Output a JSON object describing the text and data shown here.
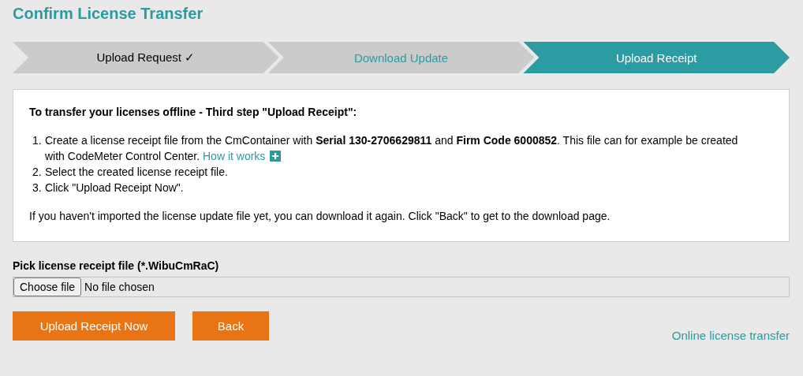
{
  "title": "Confirm License Transfer",
  "steps": [
    {
      "label": "Upload Request ✓",
      "selected": false,
      "completed": true
    },
    {
      "label": "Download Update",
      "selected": false,
      "completed": false
    },
    {
      "label": "Upload Receipt",
      "selected": true,
      "completed": false
    }
  ],
  "instructions": {
    "heading": "To transfer your licenses offline - Third step \"Upload Receipt\":",
    "items": [
      {
        "marker": "1.",
        "text": "Create a license receipt file from the CmContainer with **Serial 130-2706629811** and **Firm Code 6000852**. This file can for example be created with CodeMeter Control Center.",
        "link": "How it works"
      },
      {
        "marker": "2.",
        "text": "Select the created license receipt file."
      },
      {
        "marker": "3.",
        "text": "Click \"Upload Receipt Now\"."
      }
    ],
    "note": "If you haven't imported the license update file yet, you can download it again. Click \"Back\" to get to the download page."
  },
  "file_picker": {
    "label": "Pick license receipt file (*.WibuCmRaC)",
    "button": "Choose file",
    "status": "No file chosen"
  },
  "buttons": [
    "Upload Receipt Now",
    "Back"
  ],
  "online_link": "Online license transfer"
}
